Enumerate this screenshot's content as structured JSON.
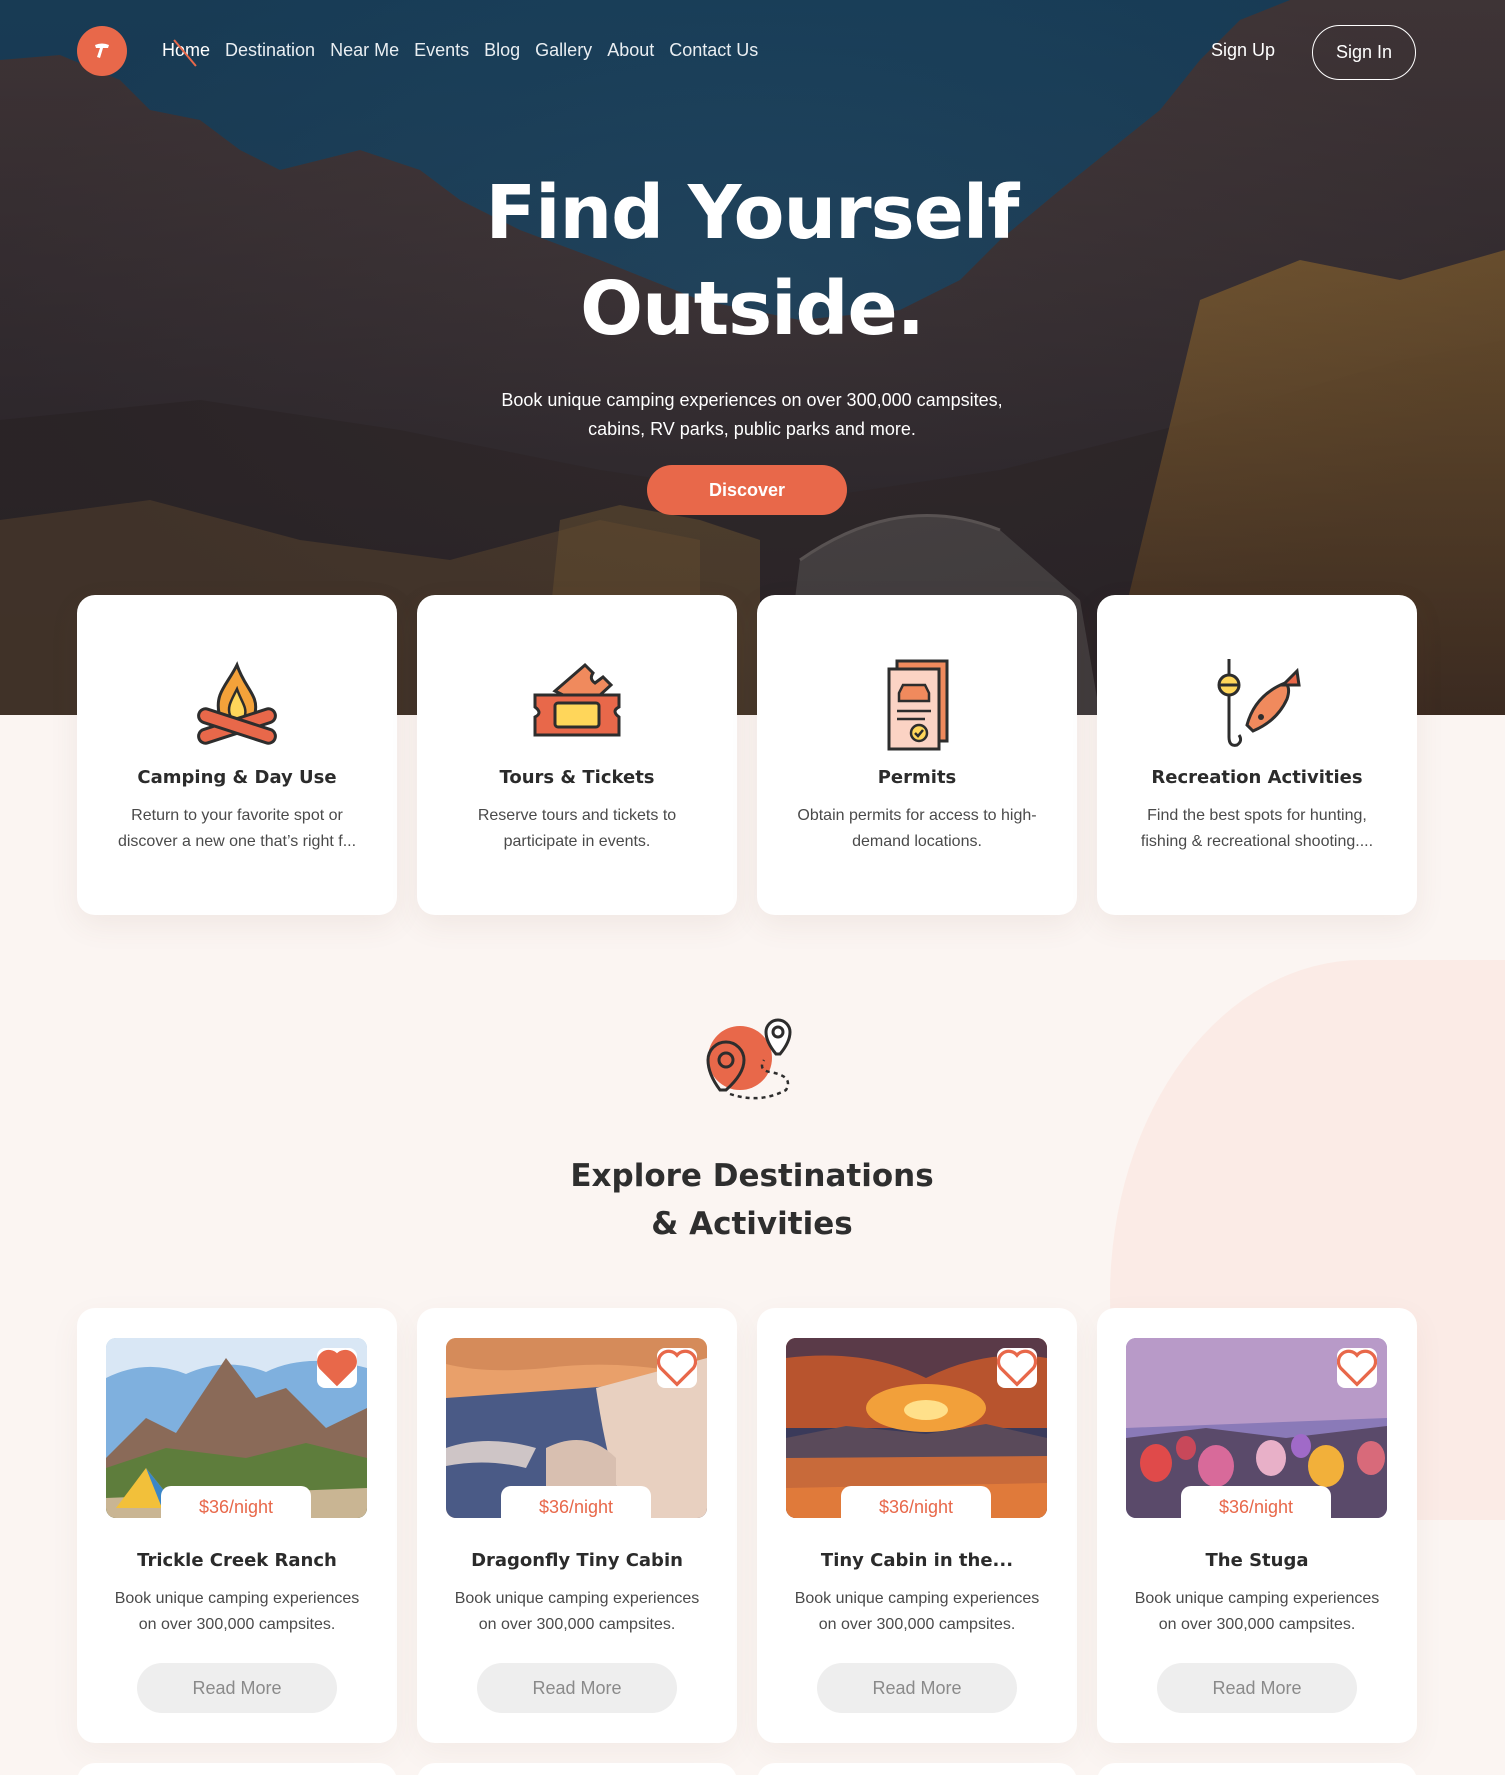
{
  "nav": {
    "items": [
      {
        "label": "Home",
        "active": true
      },
      {
        "label": "Destination"
      },
      {
        "label": "Near Me"
      },
      {
        "label": "Events"
      },
      {
        "label": "Blog"
      },
      {
        "label": "Gallery"
      },
      {
        "label": "About"
      },
      {
        "label": "Contact Us"
      }
    ],
    "signup_label": "Sign Up",
    "signin_label": "Sign In"
  },
  "hero": {
    "title_line1": "Find Yourself",
    "title_line2": "Outside.",
    "subtitle_line1": "Book unique camping experiences on over 300,000 campsites,",
    "subtitle_line2": "cabins, RV parks, public parks and more.",
    "cta_label": "Discover"
  },
  "services": [
    {
      "icon": "campfire-icon",
      "title": "Camping & Day Use",
      "desc": "Return to your favorite spot or discover a new one that’s right f..."
    },
    {
      "icon": "ticket-icon",
      "title": "Tours & Tickets",
      "desc": "Reserve tours and tickets to participate in events."
    },
    {
      "icon": "permit-document-icon",
      "title": "Permits",
      "desc": "Obtain permits for access to high-demand locations."
    },
    {
      "icon": "fishing-icon",
      "title": "Recreation Activities",
      "desc": "Find the best spots for hunting, fishing & recreational shooting...."
    }
  ],
  "explore": {
    "icon": "map-route-icon",
    "title_line1": "Explore Destinations",
    "title_line2": "& Activities"
  },
  "destinations": [
    {
      "title": "Trickle Creek Ranch",
      "price": "$36/night",
      "desc": "Book unique camping experiences on over 300,000 campsites.",
      "favorited": true,
      "read_more": "Read More"
    },
    {
      "title": "Dragonfly Tiny Cabin",
      "price": "$36/night",
      "desc": "Book unique camping experiences on over 300,000 campsites.",
      "favorited": false,
      "read_more": "Read More"
    },
    {
      "title": "Tiny Cabin in the...",
      "price": "$36/night",
      "desc": "Book unique camping experiences on over 300,000 campsites.",
      "favorited": false,
      "read_more": "Read More"
    },
    {
      "title": "The Stuga",
      "price": "$36/night",
      "desc": "Book unique camping experiences on over 300,000 campsites.",
      "favorited": false,
      "read_more": "Read More"
    }
  ],
  "colors": {
    "accent": "#e8684a",
    "background": "#fbf5f2",
    "card": "#ffffff",
    "heading": "#2b2b2b"
  }
}
